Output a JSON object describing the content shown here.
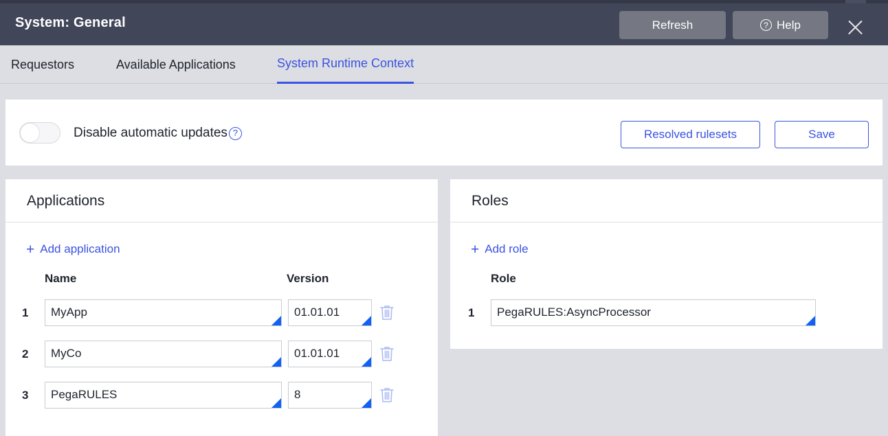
{
  "window": {
    "title": "System: General",
    "buttons": {
      "refresh": "Refresh",
      "help": "Help",
      "help_icon": "question-circle-icon",
      "close_icon": "close-icon"
    }
  },
  "tabs": [
    {
      "label": "Requestors",
      "active": false
    },
    {
      "label": "Available Applications",
      "active": false
    },
    {
      "label": "System Runtime Context",
      "active": true
    }
  ],
  "toolbar": {
    "toggle": {
      "label": "Disable automatic updates",
      "state": "off",
      "help_icon": "help-circle-icon"
    },
    "resolved_rulesets_label": "Resolved rulesets",
    "save_label": "Save"
  },
  "applications_panel": {
    "title": "Applications",
    "add_link": "Add application",
    "columns": {
      "name": "Name",
      "version": "Version"
    },
    "rows": [
      {
        "index": "1",
        "name": "MyApp",
        "version": "01.01.01",
        "delete_icon": "trash-icon"
      },
      {
        "index": "2",
        "name": "MyCo",
        "version": "01.01.01",
        "delete_icon": "trash-icon"
      },
      {
        "index": "3",
        "name": "PegaRULES",
        "version": "8",
        "delete_icon": "trash-icon"
      }
    ]
  },
  "roles_panel": {
    "title": "Roles",
    "add_link": "Add role",
    "columns": {
      "role": "Role"
    },
    "rows": [
      {
        "index": "1",
        "role": "PegaRULES:AsyncProcessor"
      }
    ]
  },
  "colors": {
    "titlebar": "#424659",
    "accent_blue": "#3b52e0",
    "corner_blue": "#1161f5",
    "page_bg": "#dcdee3",
    "header_button": "#757782",
    "trash_blue": "#a9b8f2"
  }
}
